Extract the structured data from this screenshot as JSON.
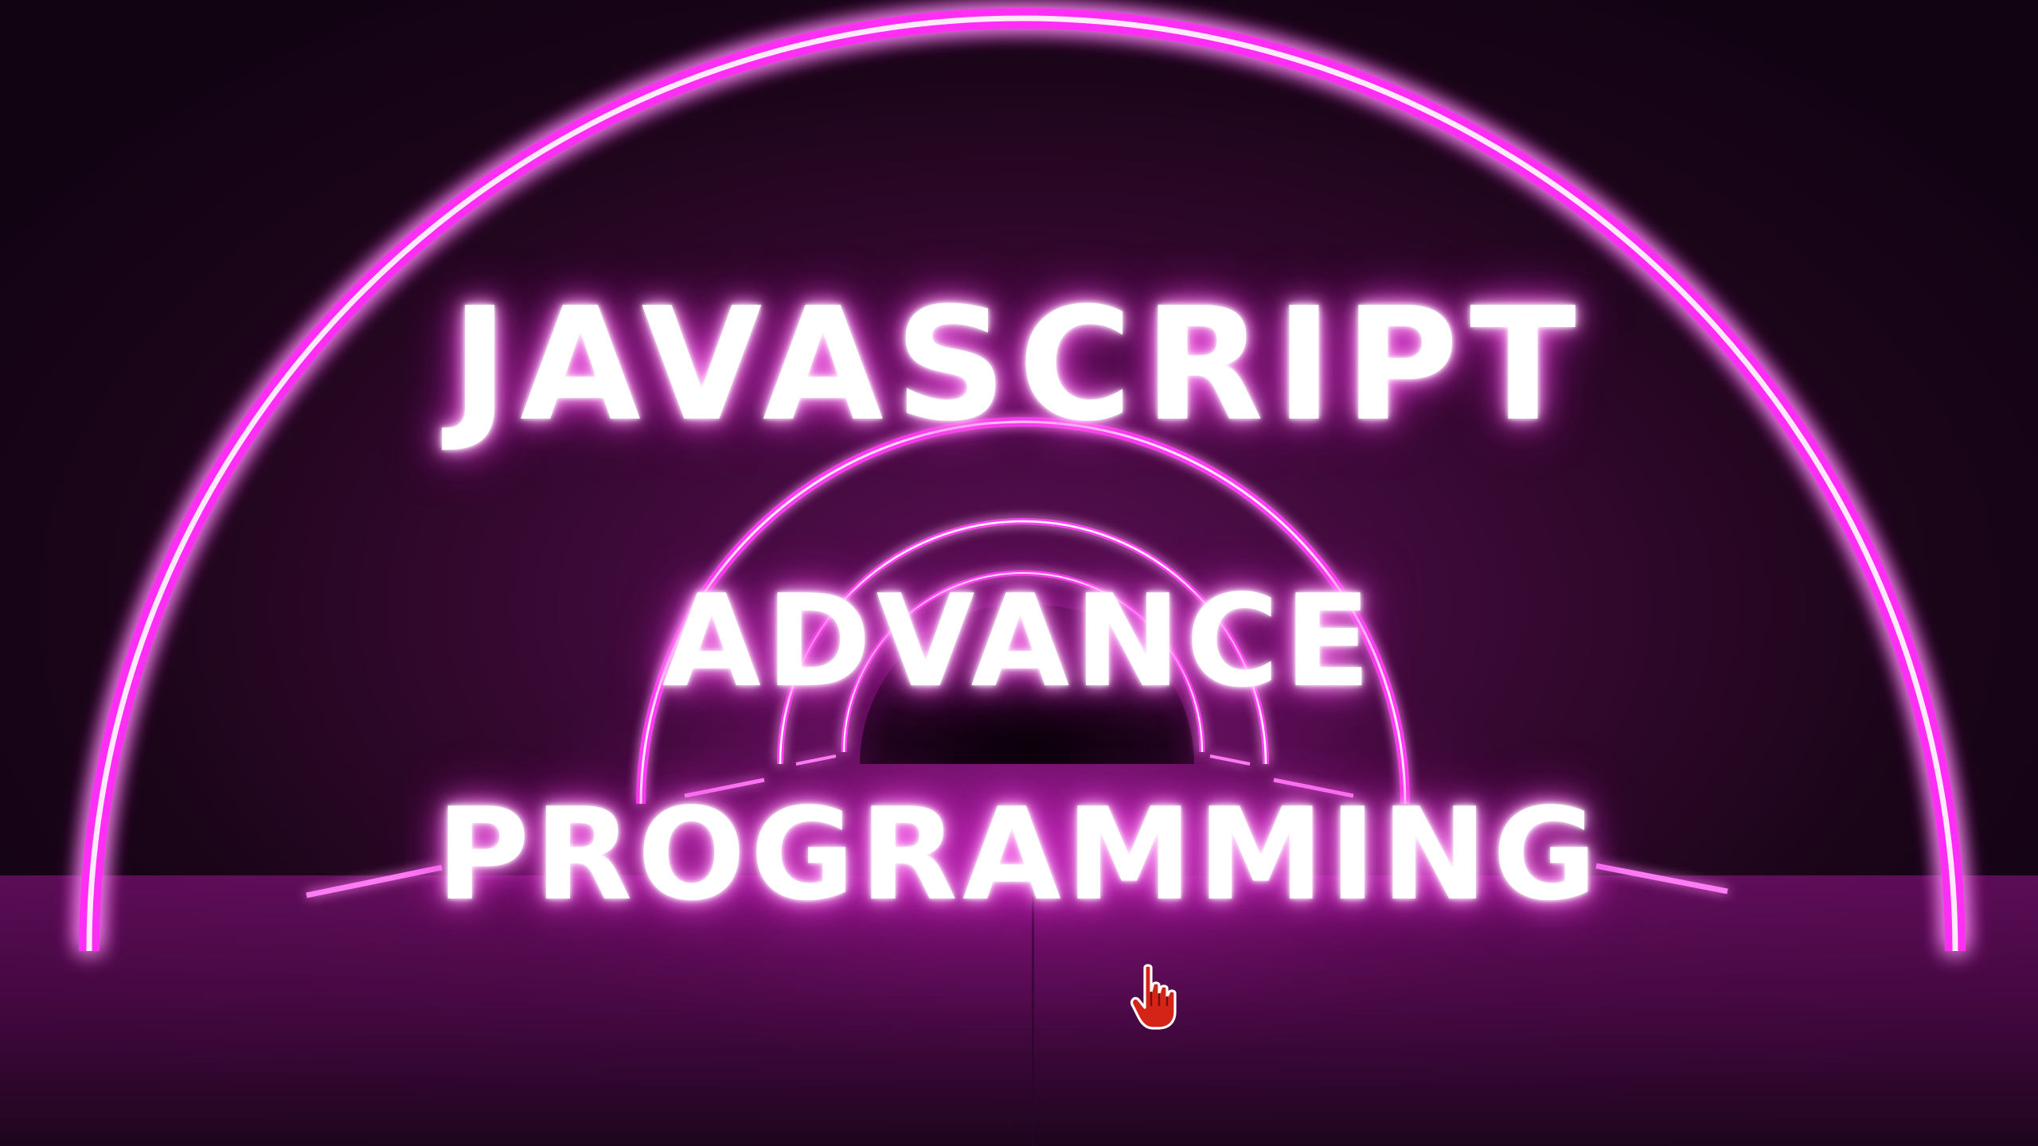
{
  "title": {
    "line1": "JAVASCRIPT",
    "line2": "ADVANCE",
    "line3": "PROGRAMMING"
  },
  "colors": {
    "neon_magenta": "#ff2ef5",
    "glow_pink": "#d41ec8",
    "text_white": "#ffffff",
    "background": "#1a0418",
    "cursor_red": "#d42418"
  },
  "icons": {
    "cursor": "hand-pointer-icon"
  }
}
